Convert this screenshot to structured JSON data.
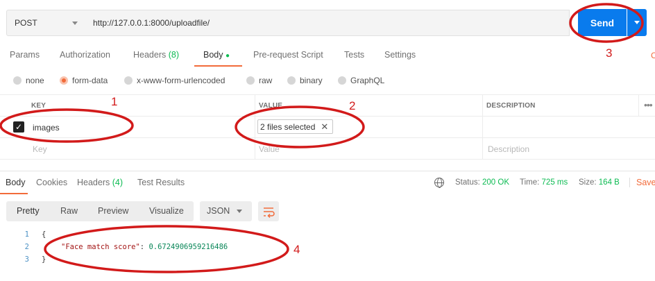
{
  "request": {
    "method": "POST",
    "url": "http://127.0.0.1:8000/uploadfile/",
    "send_label": "Send"
  },
  "request_tabs": [
    {
      "label": "Params"
    },
    {
      "label": "Authorization"
    },
    {
      "label": "Headers",
      "badge": "(8)"
    },
    {
      "label": "Body",
      "active": true
    },
    {
      "label": "Pre-request Script"
    },
    {
      "label": "Tests"
    },
    {
      "label": "Settings"
    }
  ],
  "body_types": [
    "none",
    "form-data",
    "x-www-form-urlencoded",
    "raw",
    "binary",
    "GraphQL"
  ],
  "body_type_selected": "form-data",
  "params_table": {
    "headers": [
      "KEY",
      "VALUE",
      "DESCRIPTION"
    ],
    "row": {
      "checked": true,
      "key": "images",
      "value": "2 files selected",
      "description": ""
    },
    "placeholders": {
      "key": "Key",
      "value": "Value",
      "description": "Description"
    }
  },
  "response_tabs": [
    {
      "label": "Body",
      "active": true
    },
    {
      "label": "Cookies"
    },
    {
      "label": "Headers",
      "badge": "(4)"
    },
    {
      "label": "Test Results"
    }
  ],
  "response_meta": {
    "status_label": "Status:",
    "status": "200 OK",
    "time_label": "Time:",
    "time": "725 ms",
    "size_label": "Size:",
    "size": "164 B",
    "save_label": "Save"
  },
  "view_modes": [
    "Pretty",
    "Raw",
    "Preview",
    "Visualize"
  ],
  "format": "JSON",
  "response_body": {
    "line_numbers": [
      "1",
      "2",
      "3"
    ],
    "open_brace": "{",
    "key": "\"Face match score\"",
    "colon": ": ",
    "value": "0.6724906959216486",
    "close_brace": "}"
  },
  "annotations": [
    "1",
    "2",
    "3",
    "4"
  ],
  "colors": {
    "accent": "#f26b3a",
    "send_blue": "#097bed",
    "status_green": "#0cbb52",
    "annotation_red": "#d21a1a"
  }
}
